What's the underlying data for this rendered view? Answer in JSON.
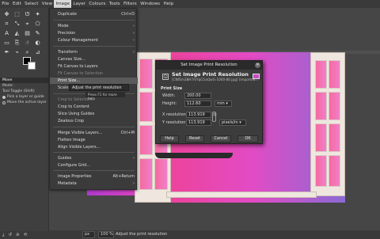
{
  "menubar": {
    "items": [
      "File",
      "Edit",
      "Select",
      "View",
      "Image",
      "Layer",
      "Colours",
      "Tools",
      "Filters",
      "Windows",
      "Help"
    ],
    "active_index": 4
  },
  "image_menu": {
    "items": [
      {
        "label": "Duplicate",
        "accel": "Ctrl+D"
      },
      {
        "label": "Mode",
        "submenu": true
      },
      {
        "label": "Precision",
        "submenu": true
      },
      {
        "label": "Colour Management",
        "submenu": true
      },
      {
        "label": "Transform",
        "submenu": true
      },
      {
        "label": "Canvas Size..."
      },
      {
        "label": "Fit Canvas to Layers"
      },
      {
        "label": "Fit Canvas to Selection",
        "disabled": true
      },
      {
        "label": "Print Size...",
        "highlighted": true
      },
      {
        "label": "Scale Image..."
      },
      {
        "label": "Crop to Selection",
        "disabled": true
      },
      {
        "label": "Crop to Content"
      },
      {
        "label": "Slice Using Guides"
      },
      {
        "label": "Zealous Crop"
      },
      {
        "label": "Merge Visible Layers...",
        "accel": "Ctrl+M"
      },
      {
        "label": "Flatten Image"
      },
      {
        "label": "Align Visible Layers..."
      },
      {
        "label": "Guides",
        "submenu": true
      },
      {
        "label": "Configure Grid..."
      },
      {
        "label": "Image Properties",
        "accel": "Alt+Return"
      },
      {
        "label": "Metadata",
        "submenu": true
      }
    ]
  },
  "tooltip": {
    "text": "Adjust the print resolution",
    "hint": "Press F1 for more help"
  },
  "tool_options": {
    "header": "Move",
    "mode_label": "Mode:",
    "toggle_label": "Tool Toggle  (Shift)",
    "option1": "Pick a layer or guide",
    "option2": "Move the active layer"
  },
  "dialog": {
    "title": "Set Image Print Resolution",
    "heading": "Set Image Print Resolution",
    "subtitle": "[CNfSm38H7mYqCGxQwG-1000-80.jpg] (imported...",
    "section": "Print Size",
    "width_label": "Width:",
    "width_value": "200.00",
    "height_label": "Height:",
    "height_value": "112.60",
    "size_unit": "mm",
    "xres_label": "X resolution:",
    "xres_value": "113.919",
    "yres_label": "Y resolution:",
    "yres_value": "113.919",
    "res_unit": "pixels/in",
    "buttons": [
      "Help",
      "Reset",
      "Cancel",
      "OK"
    ]
  },
  "statusbar": {
    "unit": "px",
    "zoom": "100 %",
    "message": "Adjust the print resolution"
  },
  "colors": {
    "menu_bg": "#3b3b3b",
    "highlight": "#5a5a5a",
    "canvas_pink": "#f0408a",
    "canvas_violet": "#8a6ad6"
  }
}
